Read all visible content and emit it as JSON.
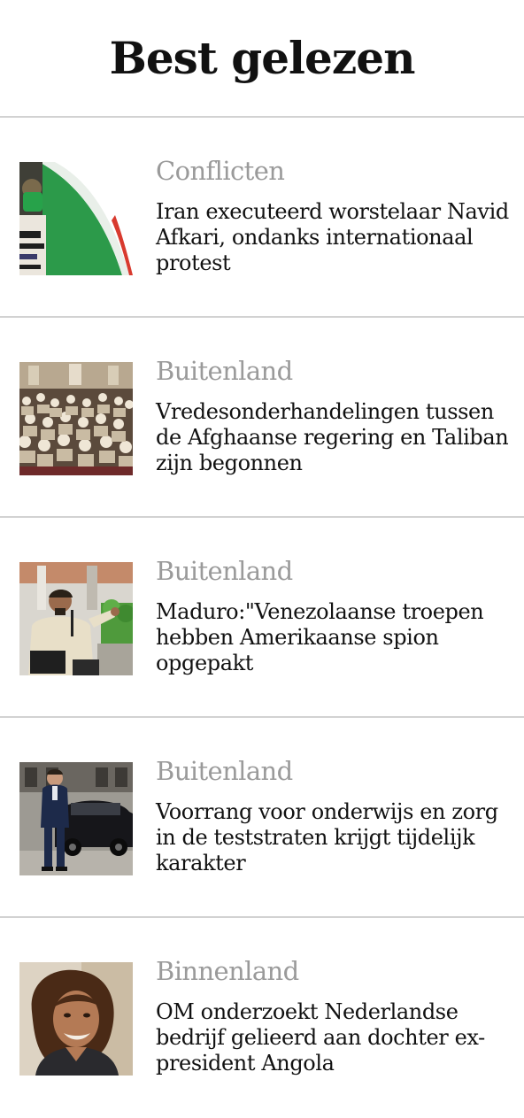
{
  "page": {
    "title": "Best gelezen"
  },
  "articles": [
    {
      "category": "Conflicten",
      "headline": "Iran executeerd worstelaar Navid Afkari, ondanks internationaal protest",
      "thumbnail_icon": "protest-flag-photo"
    },
    {
      "category": "Buitenland",
      "headline": "Vredesonderhandelingen tussen de Afghaanse regering en Taliban zijn begonnen",
      "thumbnail_icon": "conference-hall-photo"
    },
    {
      "category": "Buitenland",
      "headline": "Maduro:\"Venezolaanse troepen hebben Amerikaanse spion opgepakt",
      "thumbnail_icon": "speaker-at-podium-photo"
    },
    {
      "category": "Buitenland",
      "headline": "Voorrang voor onderwijs en zorg in de teststraten krijgt tijdelijk karakter",
      "thumbnail_icon": "man-beside-car-photo"
    },
    {
      "category": "Binnenland",
      "headline": "OM onderzoekt Nederlandse bedrijf gelieerd aan dochter ex-president Angola",
      "thumbnail_icon": "woman-portrait-photo"
    }
  ],
  "colors": {
    "title": "#111111",
    "category": "#9a9a9a",
    "headline": "#111111",
    "divider": "#d2d2d2",
    "background": "#ffffff"
  }
}
